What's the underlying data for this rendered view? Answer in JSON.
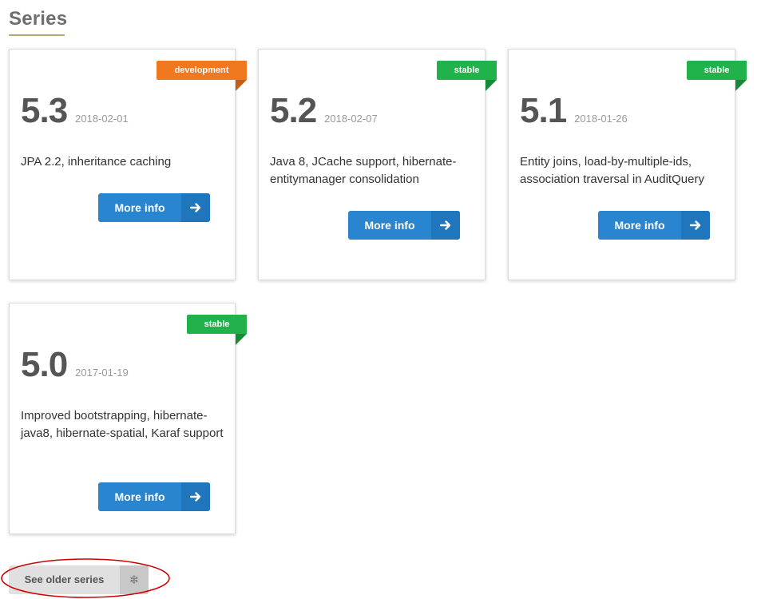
{
  "section": {
    "title": "Series"
  },
  "series": [
    {
      "version": "5.3",
      "date": "2018-02-01",
      "status": "development",
      "description": "JPA 2.2, inheritance caching",
      "button_label": "More info"
    },
    {
      "version": "5.2",
      "date": "2018-02-07",
      "status": "stable",
      "description": "Java 8, JCache support, hibernate-entitymanager consolidation",
      "button_label": "More info"
    },
    {
      "version": "5.1",
      "date": "2018-01-26",
      "status": "stable",
      "description": "Entity joins, load-by-multiple-ids, association traversal in AuditQuery",
      "button_label": "More info"
    },
    {
      "version": "5.0",
      "date": "2017-01-19",
      "status": "stable",
      "description": "Improved bootstrapping, hibernate-java8, hibernate-spatial, Karaf support",
      "button_label": "More info"
    }
  ],
  "older_series": {
    "label": "See older series",
    "icon": "snowflake-icon"
  },
  "colors": {
    "development": "#f07920",
    "stable": "#22b24c",
    "button": "#2a85d0",
    "annotation": "#cc0000"
  }
}
